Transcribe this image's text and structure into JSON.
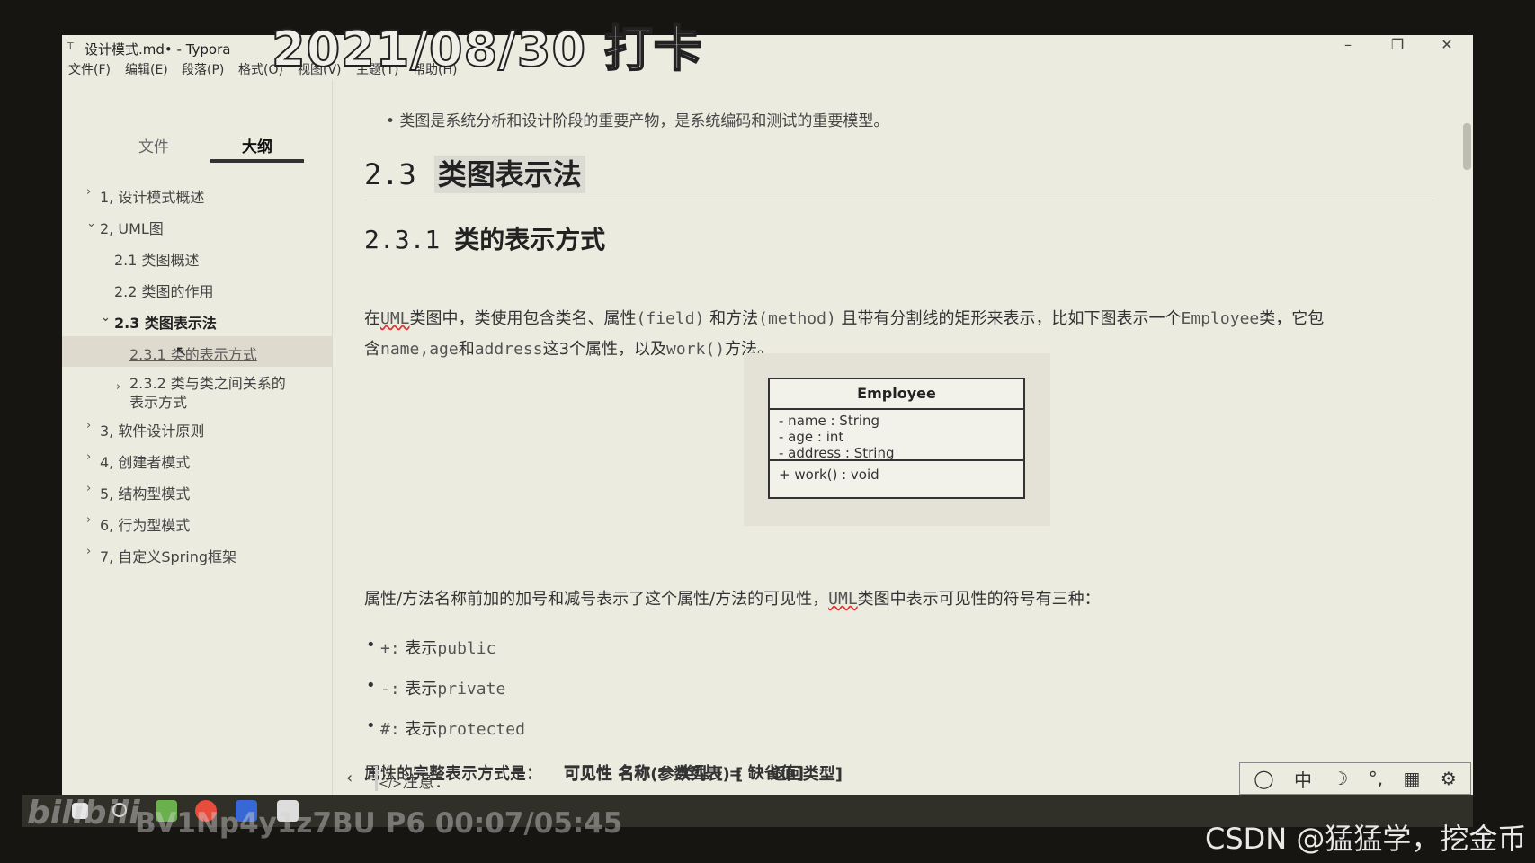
{
  "overlay": {
    "date_text": "2021/08/30 打卡",
    "bili_info": "BV1Np4y1z7BU P6 00:07/05:45",
    "bili_logo": "bilibili",
    "csdn_watermark": "CSDN @猛猛学，挖金币"
  },
  "window": {
    "title": "设计模式.md• - Typora",
    "icon": "T",
    "minimize": "–",
    "restore": "❐",
    "close": "✕"
  },
  "menu": [
    "文件(F)",
    "编辑(E)",
    "段落(P)",
    "格式(O)",
    "视图(V)",
    "主题(T)",
    "帮助(H)"
  ],
  "sidebar": {
    "tabs": [
      "文件",
      "大纲"
    ],
    "active_tab": "大纲",
    "outline": [
      {
        "caret": "›",
        "label": "1, 设计模式概述"
      },
      {
        "caret": "⌄",
        "label": "2, UML图"
      },
      {
        "caret": "",
        "label": "2.1 类图概述"
      },
      {
        "caret": "",
        "label": "2.2 类图的作用"
      },
      {
        "caret": "⌄",
        "label": "2.3 类图表示法"
      },
      {
        "caret": "",
        "label": "2.3.1 类的表示方式"
      },
      {
        "caret": "›",
        "label": "2.3.2 类与类之间关系的"
      },
      {
        "caret": "",
        "label": "表示方式"
      },
      {
        "caret": "›",
        "label": "3, 软件设计原则"
      },
      {
        "caret": "›",
        "label": "4, 创建者模式"
      },
      {
        "caret": "›",
        "label": "5, 结构型模式"
      },
      {
        "caret": "›",
        "label": "6, 行为型模式"
      },
      {
        "caret": "›",
        "label": "7, 自定义Spring框架"
      }
    ]
  },
  "editor": {
    "truncated_bullet": "• 类图是系统分析和设计阶段的重要产物，是系统编码和测试的重要模型。",
    "h2_num": "2.3",
    "h2_text": "类图表示法",
    "h3_num": "2.3.1",
    "h3_text": "类的表示方式",
    "para1": {
      "s1": "在",
      "uml": "UML",
      "s2": "类图中，类使用包含类名、属性",
      "field": "(field)",
      "s3": " 和方法",
      "method": "(method)",
      "s4": " 且带有分割线的矩形来表示，比如下图表示一个",
      "employee": "Employee",
      "s5": "类，它包",
      "line2_s1": "含",
      "name": "name",
      "comma1": ",",
      "age": "age",
      "and": "和",
      "address": "address",
      "line2_s2": "这3个属性，以及",
      "work": "work()",
      "line2_s3": "方法。"
    },
    "uml": {
      "class_name": "Employee",
      "attributes": [
        "- name : String",
        "- age : int",
        "- address : String"
      ],
      "methods": [
        "+ work() : void"
      ]
    },
    "para2": {
      "s1": "属性/方法名称前加的加号和减号表示了这个属性/方法的可见性，",
      "uml": "UML",
      "s2": "类图中表示可见性的符号有三种："
    },
    "visibility": [
      {
        "symbol": "+:",
        "text": "表示",
        "kw": "public"
      },
      {
        "symbol": "-:",
        "text": "表示",
        "kw": "private"
      },
      {
        "symbol": "#:",
        "text": "表示",
        "kw": "protected"
      }
    ],
    "attr_full": {
      "label": "属性的完整表示方式是：",
      "value": "可见性  名称 ： 类型 [ = 缺省值]"
    },
    "method_full": {
      "label": "方法的完整表示方式是：",
      "value": "可见性  名称(参数列表) [ ： 返回类型]"
    },
    "note": "注意：",
    "collapse_icon": "‹",
    "code_icon": "</>"
  },
  "ime": [
    "◯",
    "中",
    "☽",
    "°,",
    "▦",
    "⚙"
  ]
}
